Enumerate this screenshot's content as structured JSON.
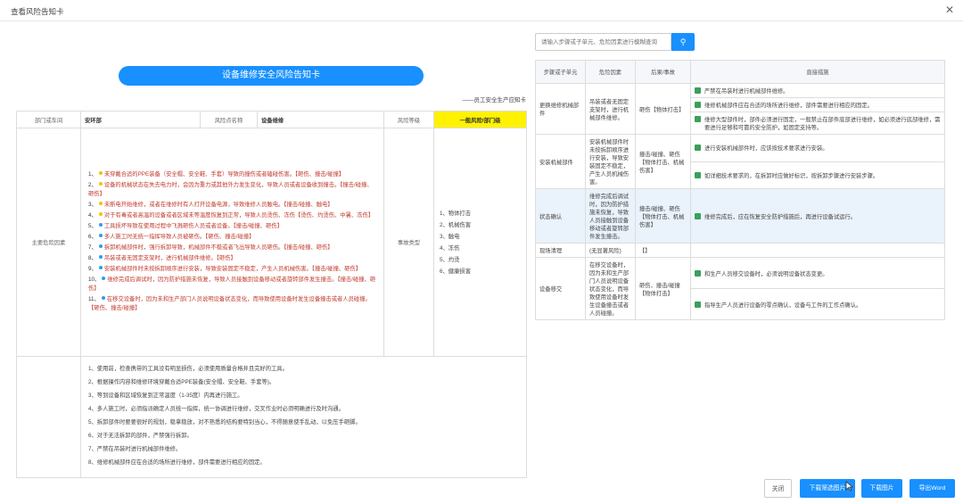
{
  "window": {
    "title": "查看风险告知卡"
  },
  "card": {
    "title": "设备维修安全风险告知卡",
    "sign": "——员工安全生产应知卡",
    "header": {
      "dept_label": "部门或车间",
      "dept_value": "安环部",
      "name_label": "风险点名称",
      "name_value": "设备维修",
      "level_label": "风险等级",
      "level_value": "一般风险/部门级"
    },
    "risk_factors_label": "主要危险因素",
    "risk_factors": [
      {
        "num": "1、",
        "dot": "#f4c20d",
        "text": "未穿戴合适的PPE装备（安全帽、安全鞋、手套）导致的撞伤或者磕碰伤害。【砸伤、撞击/碰撞】"
      },
      {
        "num": "2、",
        "dot": "#f4c20d",
        "text": "设备的机械状态在失去电力时，会因为重力或其他外力发生变化，导致人员或者设备收到撞击。【撞击/碰撞、砸伤】"
      },
      {
        "num": "3、",
        "dot": "#f4c20d",
        "text": "未断电开始维修，或者在维修时有人打开设备电源，导致维修人员触电。【撞击/碰撞、触电】"
      },
      {
        "num": "4、",
        "dot": "#f4c20d",
        "text": "对于有毒或者高温的设备或者区域未等温度恢复到正常，导致人员烫伤、冻伤【烫伤、灼烫伤、中暑、冻伤】"
      },
      {
        "num": "5、",
        "dot": "#2a9df4",
        "text": "工具损坏导致在使用过程中飞溅砸伤人员或者设备。【撞击/碰撞、砸伤】"
      },
      {
        "num": "6、",
        "dot": "#2a9df4",
        "text": "多人施工时无统一指挥导致人员被砸伤。【砸伤、撞击/碰撞】"
      },
      {
        "num": "7、",
        "dot": "#2a9df4",
        "text": "拆卸机械部件时，强行拆卸导致，机械部件不稳或者飞出导致人员砸伤。【撞击/碰撞、砸伤】"
      },
      {
        "num": "8、",
        "dot": "#2a9df4",
        "text": "吊装或者无固定支架时，进行机械部件维修。【砸伤】"
      },
      {
        "num": "9、",
        "dot": "#2a9df4",
        "text": "安装机械部件时未按拆卸顺序进行安装，导致安装固定不稳定，产生人员机械伤害。【撞击/碰撞、砸伤】"
      },
      {
        "num": "10、",
        "dot": "#2a9df4",
        "text": "维修完成后调试时，因为防护措施未恢复，导致人员接触到设备移动或者旋转部件发生撞击。【撞击/碰撞、砸伤】"
      },
      {
        "num": "11、",
        "dot": "#2a9df4",
        "text": "在移交设备时，因为未和生产部门人员说明设备状态变化，而导致使用设备时发生设备撞击或者人员碰撞。【砸伤、撞击/碰撞】"
      }
    ],
    "hazard_label": "事故类型",
    "hazards": [
      "1、物体打击",
      "2、机械伤害",
      "3、触电",
      "4、冻伤",
      "5、灼烫",
      "6、健康损害"
    ],
    "measures": [
      "1、使用前，检查携带的工具没有明显损伤，必须使用质量合格并且完好的工具。",
      "2、根据操作内容和维修环境穿戴合适PPE装备(安全帽、安全鞋、手套等)。",
      "3、等到设备和区域恢复到正常温度（1-35度）内再进行施工。",
      "4、多人施工时，必须指派确定人员统一指挥，统一协调进行维修，交叉作业时必须明确进行及时沟通。",
      "5、拆卸部件时要要很好的规划，稳拿稳放，对不熟悉的结构要特别当心，不得随意使手乱动，以免压手砸脚。",
      "6、对于无法拆卸的部件，严禁强行拆卸。",
      "7、严禁在吊装时进行机械部件维修。",
      "8、维修机械部件应在合适的场所进行维修，部件需要进行相应的固定。"
    ]
  },
  "search": {
    "placeholder": "请输入步骤或子单元、危险因素进行模糊查询"
  },
  "table": {
    "headers": [
      "步骤或子单元",
      "危险因素",
      "后果/事故",
      "直接措施"
    ],
    "rows": [
      {
        "step": "更换维修机械部件",
        "factor": "吊装或者无固定支架时，进行机械部件维修。",
        "result": "砸伤【物体打击】",
        "measures": [
          "严禁在吊装时进行机械部件维修。",
          "维修机械部件应在合适的场所进行维修，部件需要进行相应的固定。",
          "维修大型部件时，部件必须进行固定，一般禁止在部件底部进行维修，如必须进行底部维修，需要进行足够和可靠的安全防护，如固定支持等。"
        ]
      },
      {
        "step": "安装机械部件",
        "factor": "安装机械部件时未按拆卸顺序进行安装，导致安装固定不稳定，产生人员机械伤害。",
        "result": "撞击/碰撞、砸伤【物体打击、机械伤害】",
        "measures": [
          "进行安装机械部件时，应该按技术要求进行安装。",
          "如详细技术要求的，在拆卸时应做好标识，按拆卸步骤进行安装步骤。"
        ]
      },
      {
        "step": "状态确认",
        "factor": "维修完成后调试时，因为防护措施未恢复，导致人员接触到设备移动或者旋转部件发生撞击。",
        "result": "撞击/碰撞、砸伤【物体打击、机械伤害】",
        "measures": [
          "维修完成后，应在恢复安全防护措施后，再进行设备试运行。"
        ]
      },
      {
        "step": "现场清理",
        "factor": "(无显著风险)",
        "result": "【】",
        "measures": []
      },
      {
        "step": "设备移交",
        "factor": "在移交设备时，因为未和生产部门人员说明设备状态变化，而导致使用设备时发生设备撞击或者人员碰撞。",
        "result": "砸伤、撞击/碰撞【物体打击】",
        "measures": [
          "和生产人员移交设备时，必须说明设备状态变更。",
          "指导生产人员进行设备的零点确认，设备与工件的工作点确认。"
        ]
      }
    ]
  },
  "footer": {
    "close": "关闭",
    "download_filtered": "下载筛选图片",
    "download_image": "下载图片",
    "export_word": "导出Word"
  },
  "colors": {
    "primary": "#1890ff",
    "level_yellow": "#fff200",
    "measure_icon": "#3aa05a"
  }
}
